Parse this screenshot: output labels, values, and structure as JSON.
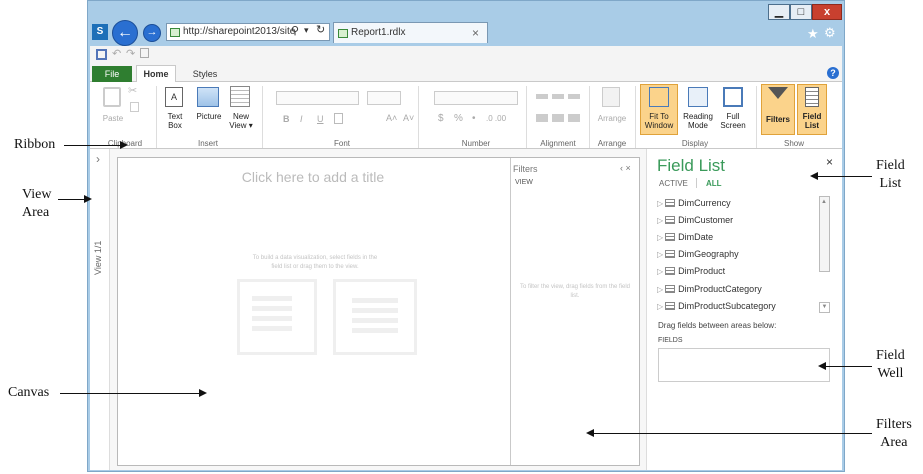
{
  "browser": {
    "url": "http://sharepoint2013/site",
    "tab_title": "Report1.rdlx",
    "tab_close": "×",
    "window_buttons": {
      "minimize": "▁",
      "maximize": "□",
      "close": "x"
    },
    "search_icon": "⚲",
    "refresh_icon": "↻",
    "dropdown_arrow": "▾",
    "star_icon": "★",
    "gear_icon": "⚙"
  },
  "ribbon": {
    "tabs": {
      "file": "File",
      "home": "Home",
      "styles": "Styles"
    },
    "help_icon": "?",
    "groups": {
      "clipboard": {
        "label": "Clipboard",
        "paste": "Paste"
      },
      "insert": {
        "label": "Insert",
        "text_box": [
          "Text",
          "Box"
        ],
        "picture": "Picture",
        "new_view": [
          "New",
          "View ▾"
        ]
      },
      "font": {
        "label": "Font",
        "bold": "B",
        "italic": "I",
        "underline": "U",
        "grow": "A˄",
        "shrink": "A˅"
      },
      "number": {
        "label": "Number",
        "currency": "$",
        "percent": "%",
        "comma": "•",
        "inc_dec": ".0 .00"
      },
      "alignment": {
        "label": "Alignment"
      },
      "arrange": {
        "label": "Arrange",
        "arrange": "Arrange"
      },
      "display": {
        "label": "Display",
        "fit_to_window": [
          "Fit To",
          "Window"
        ],
        "reading_mode": [
          "Reading",
          "Mode"
        ],
        "full_screen": [
          "Full",
          "Screen"
        ]
      },
      "show": {
        "label": "Show",
        "filters": "Filters",
        "field_list": [
          "Field",
          "List"
        ]
      }
    }
  },
  "view_strip": {
    "chevron": "›",
    "label": "View 1/1"
  },
  "canvas": {
    "title_placeholder": "Click here to add a title",
    "hint": "To build a data visualization, select fields in the field list or drag them to the view."
  },
  "filters_pane": {
    "title": "Filters",
    "controls": "‹ ×",
    "subtitle": "VIEW",
    "hint": "To filter the view, drag fields from the field list."
  },
  "field_list": {
    "title": "Field List",
    "close": "×",
    "tabs": {
      "active": "ACTIVE",
      "all": "ALL"
    },
    "items": [
      "DimCurrency",
      "DimCustomer",
      "DimDate",
      "DimGeography",
      "DimProduct",
      "DimProductCategory",
      "DimProductSubcategory"
    ],
    "drag_hint": "Drag fields between areas below:",
    "fields_label": "FIELDS"
  },
  "annotations": {
    "ribbon": "Ribbon",
    "view_area": [
      "View",
      "Area"
    ],
    "canvas": "Canvas",
    "field_list": [
      "Field",
      "List"
    ],
    "field_well": [
      "Field",
      "Well"
    ],
    "filters_area": [
      "Filters",
      "Area"
    ]
  },
  "colors": {
    "accent_green": "#2f7e30",
    "highlight": "#fbd38b",
    "browser_frame": "#a9cce7",
    "field_list_title": "#3a9a5a"
  }
}
